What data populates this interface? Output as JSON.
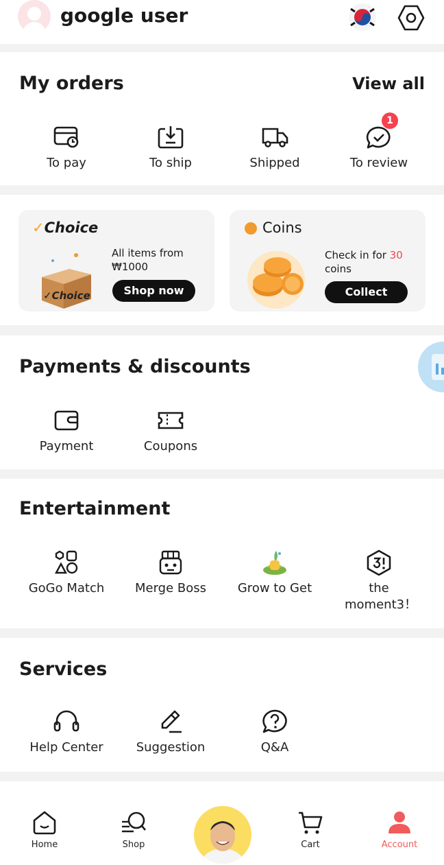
{
  "header": {
    "username": "google user",
    "flag": "korea-flag-icon",
    "settings": "settings-hex-icon"
  },
  "orders": {
    "title": "My orders",
    "view_all": "View all",
    "items": [
      {
        "label": "To pay",
        "icon": "bill-clock-icon"
      },
      {
        "label": "To ship",
        "icon": "package-in-icon"
      },
      {
        "label": "Shipped",
        "icon": "truck-icon"
      },
      {
        "label": "To review",
        "icon": "chat-check-icon",
        "badge": "1"
      }
    ]
  },
  "promo": {
    "choice": {
      "brand": "Choice",
      "check": "✓",
      "box_text": "✓Choice",
      "line1": "All items from",
      "line2": "₩1000",
      "button": "Shop now"
    },
    "coins": {
      "title": "Coins",
      "text_pre": "Check in for ",
      "amount": "30",
      "text_post": "coins",
      "button": "Collect"
    }
  },
  "payments": {
    "title": "Payments & discounts",
    "items": [
      {
        "label": "Payment",
        "icon": "wallet-icon"
      },
      {
        "label": "Coupons",
        "icon": "ticket-icon"
      }
    ]
  },
  "entertainment": {
    "title": "Entertainment",
    "items": [
      {
        "label": "GoGo Match",
        "icon": "match-shapes-icon"
      },
      {
        "label": "Merge Boss",
        "icon": "robot-icon"
      },
      {
        "label": "Grow to Get",
        "icon": "plant-icon"
      },
      {
        "label": "the moment3！",
        "icon": "moment3-hex-icon"
      }
    ]
  },
  "services": {
    "title": "Services",
    "items": [
      {
        "label": "Help Center",
        "icon": "headset-icon"
      },
      {
        "label": "Suggestion",
        "icon": "pencil-icon"
      },
      {
        "label": "Q&A",
        "icon": "question-bubble-icon"
      }
    ]
  },
  "bottom_nav": {
    "items": [
      {
        "label": "Home",
        "icon": "home-icon"
      },
      {
        "label": "Shop",
        "icon": "shop-search-icon"
      },
      {
        "label": "Cart",
        "icon": "cart-icon"
      },
      {
        "label": "Account",
        "icon": "account-icon",
        "active": true
      }
    ]
  },
  "colors": {
    "accent": "#f5424e",
    "active_nav": "#f05b5b",
    "choice_yellow": "#f5a623",
    "coin": "#f29a2e"
  }
}
